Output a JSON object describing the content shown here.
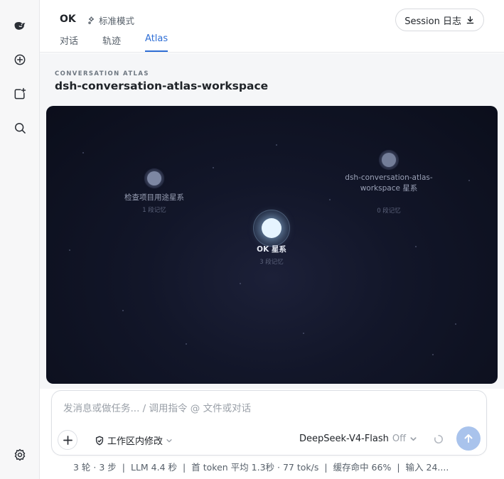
{
  "rail": {
    "icons": [
      "whale-logo-icon",
      "new-chat-icon",
      "new-task-icon",
      "search-icon",
      "settings-icon"
    ]
  },
  "header": {
    "title": "OK",
    "mode_label": "标准模式",
    "tabs": [
      {
        "label": "对话",
        "active": false
      },
      {
        "label": "轨迹",
        "active": false
      },
      {
        "label": "Atlas",
        "active": true
      }
    ],
    "session_button": "Session 日志"
  },
  "main": {
    "eyebrow": "CONVERSATION ATLAS",
    "workspace_name": "dsh-conversation-atlas-workspace"
  },
  "atlas": {
    "nodes": [
      {
        "label": "检查项目用途星系",
        "sub": "1 段记忆"
      },
      {
        "label": "OK 星系",
        "sub": "3 段记忆"
      },
      {
        "label": "dsh-conversation-atlas-workspace 星系",
        "sub": "0 段记忆"
      }
    ]
  },
  "composer": {
    "placeholder": "发消息或做任务... / 调用指令 @ 文件或对话",
    "value": "",
    "scope_label": "工作区内修改",
    "model_name": "DeepSeek-V4-Flash",
    "model_toggle": "Off"
  },
  "status": {
    "items": [
      "3 轮 · 3 步",
      "LLM 4.4 秒",
      "首 token 平均 1.3秒 · 77 tok/s",
      "缓存命中 66%",
      "输入 24...."
    ],
    "separator": "|"
  },
  "colors": {
    "accent": "#2f6fd6",
    "send_button": "#a9c3ec",
    "atlas_background": "#0b0e1b"
  }
}
